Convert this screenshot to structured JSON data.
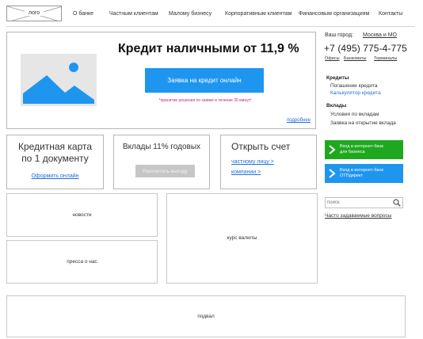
{
  "header": {
    "logo_text": "лого",
    "nav": [
      "О банке",
      "Частным клиентам",
      "Малому бизнесу",
      "Корпоративным клиентам",
      "Финансовым организациям",
      "Контакты"
    ]
  },
  "hero": {
    "title": "Кредит наличными от  11,9 %",
    "button_label": "Заявка на кредит онлайн",
    "note": "*принятие решения по заявке в течение 30 минут!",
    "more_link": "подробнее"
  },
  "contacts": {
    "city_label": "Ваш город:",
    "city_value": "Москва и МО",
    "phone": "+7 (495) 775-4-775",
    "links": [
      "Офисы",
      "Банкоматы",
      "Терминалы"
    ]
  },
  "credits": {
    "heading": "Кредиты",
    "items": [
      "Погашение кредита",
      "Калькулятор кредита"
    ]
  },
  "deposits": {
    "heading": "Вклады",
    "items": [
      "Условия по вкладам",
      "Заявка на открытие вклада"
    ]
  },
  "promo_card": {
    "title_line1": "Кредитная карта",
    "title_line2": "по 1 документу",
    "link": "Оформить онлайн"
  },
  "promo_deposit": {
    "title": "Вклады 11% годовых",
    "button_label": "Рассчитать выгоду"
  },
  "promo_account": {
    "title": "Открыть счет",
    "link_private": "частному лицу >",
    "link_company": "компании >"
  },
  "internet_bank": {
    "business_line1": "Вход в интернет-банк",
    "business_line2": "для бизнеса",
    "otp_line1": "Вход в интернет-банк",
    "otp_line2": "ОТПдирект"
  },
  "search": {
    "placeholder": "поиск",
    "faq_link": "Часто задаваемые вопросы"
  },
  "blocks": {
    "news": "новости",
    "press": "пресса о нас",
    "rates": "курс валюты",
    "footer": "подвал"
  },
  "colors": {
    "primary_blue": "#1e96ef",
    "business_green": "#1fa81f",
    "link_blue": "#1f6fd6",
    "note_magenta": "#c8238a"
  }
}
